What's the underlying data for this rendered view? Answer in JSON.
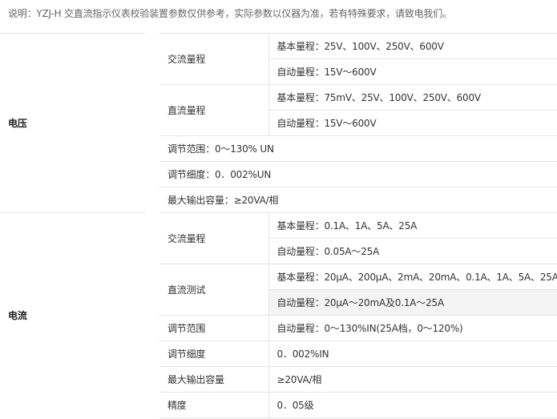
{
  "note": "说明：YZJ-H 交直流指示仪表校验装置参数仅供参考，实际参数以仪器为准，若有特殊要求，请致电我们。",
  "voltage": {
    "label": "电压",
    "ac": {
      "label": "交流量程",
      "basic": "基本量程：25V、100V、250V、600V",
      "auto": "自动量程：15V～600V"
    },
    "dc": {
      "label": "直流量程",
      "basic": "基本量程：75mV、25V、100V、250V、600V",
      "auto": "自动量程：15V～600V"
    },
    "range": "调节范围：0～130% UN",
    "fineness": "调节细度：0．002%UN",
    "capacity": "最大输出容量：≥20VA/相"
  },
  "current": {
    "label": "电流",
    "ac": {
      "label": "交流量程",
      "basic": "基本量程：0.1A、1A、5A、25A",
      "auto": "自动量程：0.05A～25A"
    },
    "dc": {
      "label": "直流测试",
      "basic": "基本量程：20μA、200μA、2mA、20mA、0.1A、1A、5A、25A",
      "auto": "自动量程：20μA～20mA及0.1A～25A"
    },
    "range": {
      "label": "调节范围",
      "value": "自动量程：0～130%IN(25A档，0～120%)"
    },
    "fineness": {
      "label": "调节细度",
      "value": "0．002%IN"
    },
    "capacity": {
      "label": "最大输出容量",
      "value": "≥20VA/相"
    },
    "accuracy": {
      "label": "精度",
      "value": "0．05级"
    }
  }
}
